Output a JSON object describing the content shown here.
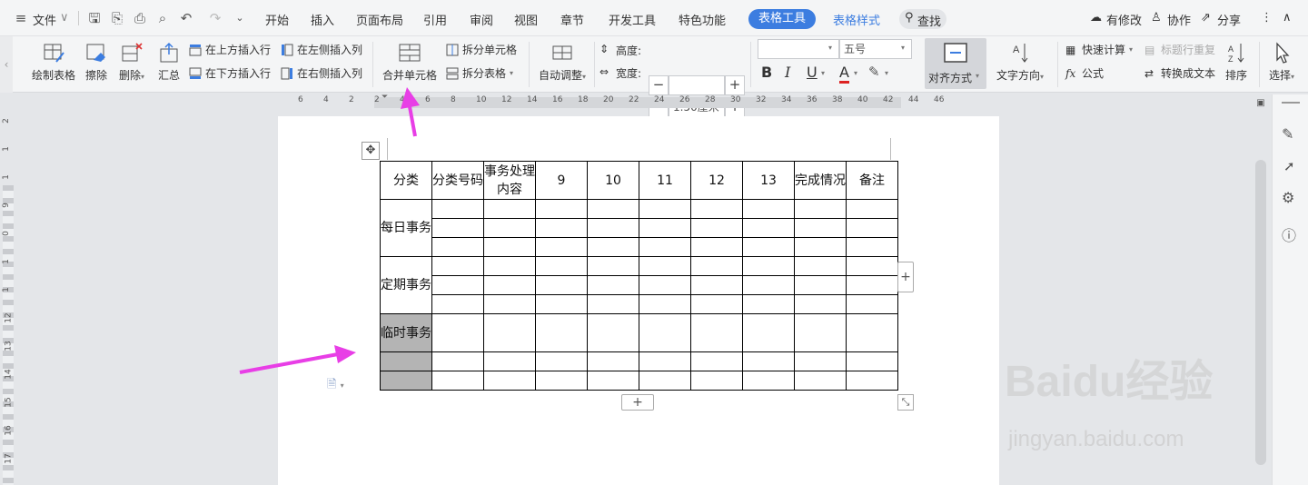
{
  "menubar": {
    "file": "文件",
    "tabs": [
      "开始",
      "插入",
      "页面布局",
      "引用",
      "审阅",
      "视图",
      "章节",
      "开发工具",
      "特色功能"
    ],
    "active_tab": "表格工具",
    "style_tab": "表格样式",
    "search": "查找",
    "modified": "有修改",
    "collab": "协作",
    "share": "分享"
  },
  "ribbon": {
    "draw_table": "绘制表格",
    "erase": "擦除",
    "delete": "删除",
    "summary": "汇总",
    "insert_above": "在上方插入行",
    "insert_below": "在下方插入行",
    "insert_left": "在左侧插入列",
    "insert_right": "在右侧插入列",
    "merge_cells": "合并单元格",
    "split_cells": "拆分单元格",
    "split_table": "拆分表格",
    "auto_fit": "自动调整",
    "height_label": "高度:",
    "height_value": "",
    "width_label": "宽度:",
    "width_value": "1.50厘米",
    "font_name": "",
    "font_size": "五号",
    "align": "对齐方式",
    "text_dir": "文字方向",
    "quick_calc": "快速计算",
    "title_repeat": "标题行重复",
    "formula": "公式",
    "to_text": "转换成文本",
    "sort": "排序",
    "select": "选择"
  },
  "hruler": [
    "6",
    "4",
    "2",
    "2",
    "4",
    "6",
    "8",
    "10",
    "12",
    "14",
    "16",
    "18",
    "20",
    "22",
    "24",
    "26",
    "28",
    "30",
    "32",
    "34",
    "36",
    "38",
    "40",
    "42",
    "44",
    "46"
  ],
  "vruler": [
    "2",
    "1",
    "1",
    "9",
    "0",
    "1",
    "1",
    "12",
    "13",
    "14",
    "15",
    "16",
    "17"
  ],
  "table": {
    "headers": [
      "分类",
      "分类号码",
      "事务处理内容",
      "9",
      "10",
      "11",
      "12",
      "13",
      "完成情况",
      "备注"
    ],
    "groups": [
      "每日事务",
      "定期事务",
      "临时事务"
    ]
  },
  "colors": {
    "accent": "#3c7de0",
    "arrow": "#e83ee6",
    "selected_cell": "#b4b4b4"
  },
  "watermark": {
    "brand": "Baidu经验",
    "url": "jingyan.baidu.com"
  }
}
